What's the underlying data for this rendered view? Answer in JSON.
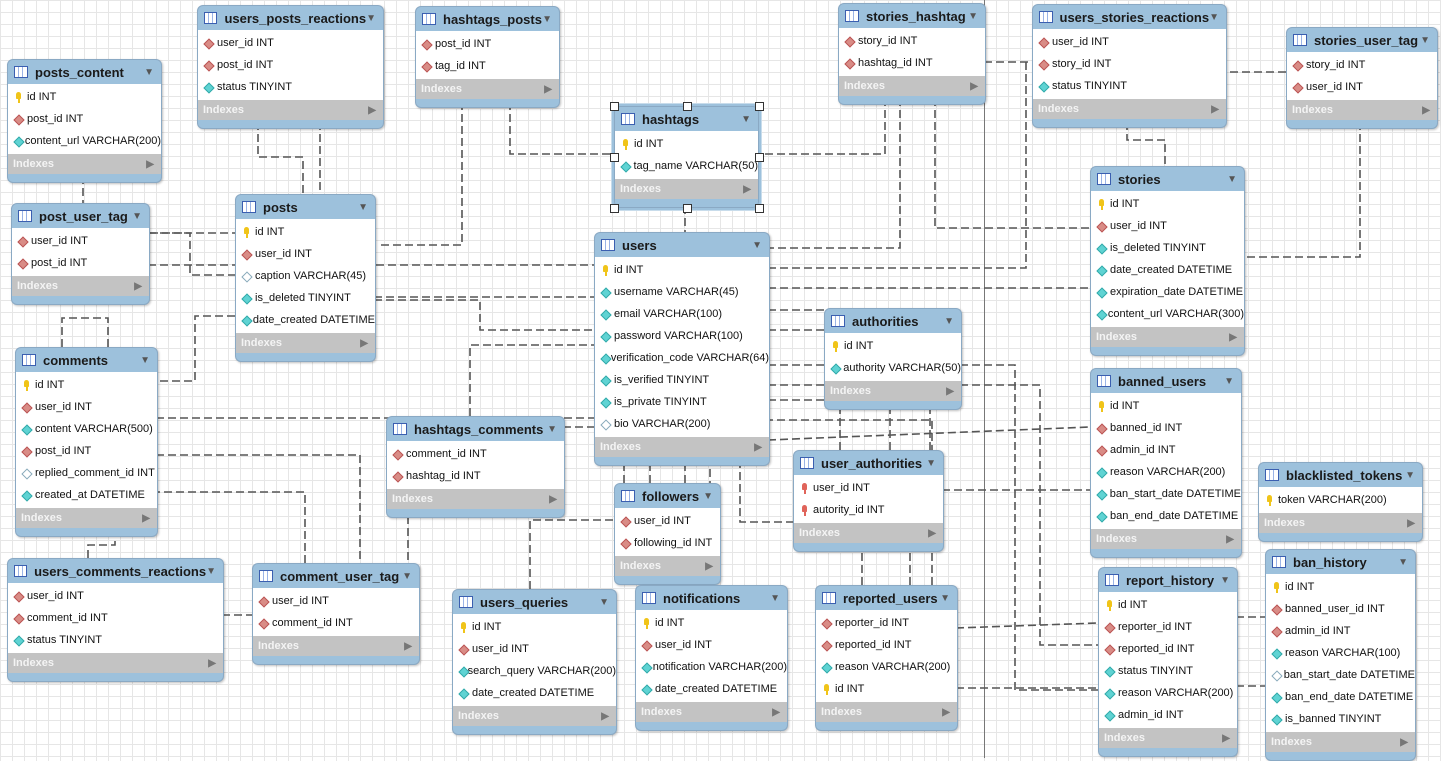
{
  "diagram": {
    "indexes_label": "Indexes",
    "colors": {
      "header": "#9dc1dc",
      "indexes": "#c3c3c3",
      "line": "#555555"
    },
    "selected_table": "hashtags",
    "tables": [
      {
        "name": "posts_content",
        "columns": [
          {
            "text": "id INT",
            "icon": "pk"
          },
          {
            "text": "post_id INT",
            "icon": "fk"
          },
          {
            "text": "content_url VARCHAR(200)",
            "icon": "nn"
          }
        ]
      },
      {
        "name": "users_posts_reactions",
        "columns": [
          {
            "text": "user_id INT",
            "icon": "fk"
          },
          {
            "text": "post_id INT",
            "icon": "fk"
          },
          {
            "text": "status TINYINT",
            "icon": "nn"
          }
        ]
      },
      {
        "name": "hashtags_posts",
        "columns": [
          {
            "text": "post_id INT",
            "icon": "fk"
          },
          {
            "text": "tag_id INT",
            "icon": "fk"
          }
        ]
      },
      {
        "name": "hashtags",
        "columns": [
          {
            "text": "id INT",
            "icon": "pk"
          },
          {
            "text": "tag_name VARCHAR(50)",
            "icon": "nn"
          }
        ]
      },
      {
        "name": "stories_hashtag",
        "columns": [
          {
            "text": "story_id INT",
            "icon": "fk"
          },
          {
            "text": "hashtag_id INT",
            "icon": "fk"
          }
        ]
      },
      {
        "name": "users_stories_reactions",
        "columns": [
          {
            "text": "user_id INT",
            "icon": "fk"
          },
          {
            "text": "story_id INT",
            "icon": "fk"
          },
          {
            "text": "status TINYINT",
            "icon": "nn"
          }
        ]
      },
      {
        "name": "stories_user_tag",
        "columns": [
          {
            "text": "story_id INT",
            "icon": "fk"
          },
          {
            "text": "user_id INT",
            "icon": "fk"
          }
        ]
      },
      {
        "name": "post_user_tag",
        "columns": [
          {
            "text": "user_id INT",
            "icon": "fk"
          },
          {
            "text": "post_id INT",
            "icon": "fk"
          }
        ]
      },
      {
        "name": "posts",
        "columns": [
          {
            "text": "id INT",
            "icon": "pk"
          },
          {
            "text": "user_id INT",
            "icon": "fk"
          },
          {
            "text": "caption VARCHAR(45)",
            "icon": "null"
          },
          {
            "text": "is_deleted TINYINT",
            "icon": "nn"
          },
          {
            "text": "date_created DATETIME",
            "icon": "nn"
          }
        ]
      },
      {
        "name": "users",
        "columns": [
          {
            "text": "id INT",
            "icon": "pk"
          },
          {
            "text": "username VARCHAR(45)",
            "icon": "nn"
          },
          {
            "text": "email VARCHAR(100)",
            "icon": "nn"
          },
          {
            "text": "password VARCHAR(100)",
            "icon": "nn"
          },
          {
            "text": "verification_code VARCHAR(64)",
            "icon": "nn"
          },
          {
            "text": "is_verified TINYINT",
            "icon": "nn"
          },
          {
            "text": "is_private TINYINT",
            "icon": "nn"
          },
          {
            "text": "bio VARCHAR(200)",
            "icon": "null"
          }
        ]
      },
      {
        "name": "stories",
        "columns": [
          {
            "text": "id INT",
            "icon": "pk"
          },
          {
            "text": "user_id INT",
            "icon": "fk"
          },
          {
            "text": "is_deleted TINYINT",
            "icon": "nn"
          },
          {
            "text": "date_created DATETIME",
            "icon": "nn"
          },
          {
            "text": "expiration_date DATETIME",
            "icon": "nn"
          },
          {
            "text": "content_url VARCHAR(300)",
            "icon": "nn"
          }
        ]
      },
      {
        "name": "comments",
        "columns": [
          {
            "text": "id INT",
            "icon": "pk"
          },
          {
            "text": "user_id INT",
            "icon": "fk"
          },
          {
            "text": "content VARCHAR(500)",
            "icon": "nn"
          },
          {
            "text": "post_id INT",
            "icon": "fk"
          },
          {
            "text": "replied_comment_id INT",
            "icon": "null"
          },
          {
            "text": "created_at DATETIME",
            "icon": "nn"
          }
        ]
      },
      {
        "name": "authorities",
        "columns": [
          {
            "text": "id INT",
            "icon": "pk"
          },
          {
            "text": "authority VARCHAR(50)",
            "icon": "nn"
          }
        ]
      },
      {
        "name": "banned_users",
        "columns": [
          {
            "text": "id INT",
            "icon": "pk"
          },
          {
            "text": "banned_id INT",
            "icon": "fk"
          },
          {
            "text": "admin_id INT",
            "icon": "fk"
          },
          {
            "text": "reason VARCHAR(200)",
            "icon": "nn"
          },
          {
            "text": "ban_start_date DATETIME",
            "icon": "nn"
          },
          {
            "text": "ban_end_date DATETIME",
            "icon": "nn"
          }
        ]
      },
      {
        "name": "hashtags_comments",
        "columns": [
          {
            "text": "comment_id INT",
            "icon": "fk"
          },
          {
            "text": "hashtag_id INT",
            "icon": "fk"
          }
        ]
      },
      {
        "name": "user_authorities",
        "columns": [
          {
            "text": "user_id INT",
            "icon": "pkfk"
          },
          {
            "text": "autority_id INT",
            "icon": "pkfk"
          }
        ]
      },
      {
        "name": "blacklisted_tokens",
        "columns": [
          {
            "text": "token VARCHAR(200)",
            "icon": "pk"
          }
        ]
      },
      {
        "name": "followers",
        "columns": [
          {
            "text": "user_id INT",
            "icon": "fk"
          },
          {
            "text": "following_id INT",
            "icon": "fk"
          }
        ]
      },
      {
        "name": "users_comments_reactions",
        "columns": [
          {
            "text": "user_id INT",
            "icon": "fk"
          },
          {
            "text": "comment_id INT",
            "icon": "fk"
          },
          {
            "text": "status TINYINT",
            "icon": "nn"
          }
        ]
      },
      {
        "name": "comment_user_tag",
        "columns": [
          {
            "text": "user_id INT",
            "icon": "fk"
          },
          {
            "text": "comment_id INT",
            "icon": "fk"
          }
        ]
      },
      {
        "name": "users_queries",
        "columns": [
          {
            "text": "id INT",
            "icon": "pk"
          },
          {
            "text": "user_id INT",
            "icon": "fk"
          },
          {
            "text": "search_query VARCHAR(200)",
            "icon": "nn"
          },
          {
            "text": "date_created DATETIME",
            "icon": "nn"
          }
        ]
      },
      {
        "name": "notifications",
        "columns": [
          {
            "text": "id INT",
            "icon": "pk"
          },
          {
            "text": "user_id INT",
            "icon": "fk"
          },
          {
            "text": "notification VARCHAR(200)",
            "icon": "nn"
          },
          {
            "text": "date_created DATETIME",
            "icon": "nn"
          }
        ]
      },
      {
        "name": "reported_users",
        "columns": [
          {
            "text": "reporter_id INT",
            "icon": "fk"
          },
          {
            "text": "reported_id INT",
            "icon": "fk"
          },
          {
            "text": "reason VARCHAR(200)",
            "icon": "nn"
          },
          {
            "text": "id INT",
            "icon": "pk"
          }
        ]
      },
      {
        "name": "report_history",
        "columns": [
          {
            "text": "id INT",
            "icon": "pk"
          },
          {
            "text": "reporter_id INT",
            "icon": "fk"
          },
          {
            "text": "reported_id INT",
            "icon": "fk"
          },
          {
            "text": "status TINYINT",
            "icon": "nn"
          },
          {
            "text": "reason VARCHAR(200)",
            "icon": "nn"
          },
          {
            "text": "admin_id INT",
            "icon": "nn"
          }
        ]
      },
      {
        "name": "ban_history",
        "columns": [
          {
            "text": "id INT",
            "icon": "pk"
          },
          {
            "text": "banned_user_id INT",
            "icon": "fk"
          },
          {
            "text": "admin_id INT",
            "icon": "fk"
          },
          {
            "text": "reason VARCHAR(100)",
            "icon": "nn"
          },
          {
            "text": "ban_start_date DATETIME",
            "icon": "null"
          },
          {
            "text": "ban_end_date DATETIME",
            "icon": "nn"
          },
          {
            "text": "is_banned TINYINT",
            "icon": "nn"
          }
        ]
      }
    ]
  }
}
